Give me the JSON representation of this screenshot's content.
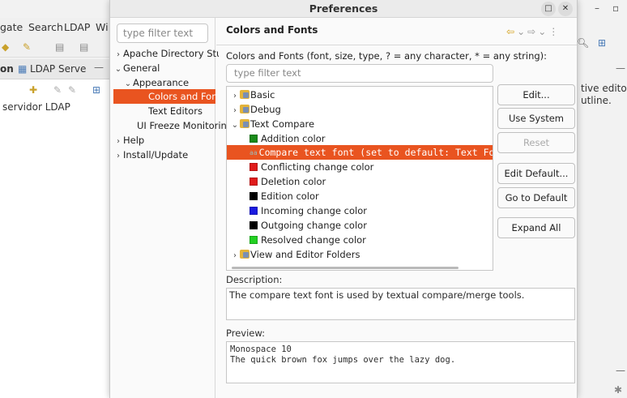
{
  "background_window": {
    "menu": [
      "gate",
      "Search",
      "LDAP",
      "Wi"
    ],
    "tabs": [
      "on",
      "LDAP Serve"
    ],
    "left_text": "servidor LDAP",
    "right_text_1": "tive editor th",
    "right_text_2": "utline."
  },
  "dialog": {
    "title": "Preferences",
    "minimize_icon": "□",
    "close_icon": "✕"
  },
  "left_tree": {
    "filter_placeholder": "type filter text",
    "items": [
      {
        "label": "Apache Directory Stu",
        "arrow": "›"
      },
      {
        "label": "General",
        "arrow": "⌄"
      },
      {
        "label": "Appearance",
        "arrow": "⌄"
      },
      {
        "label": "Colors and Fonts",
        "arrow": ""
      },
      {
        "label": "Text Editors",
        "arrow": ""
      },
      {
        "label": "UI Freeze Monitorin",
        "arrow": ""
      },
      {
        "label": "Help",
        "arrow": "›"
      },
      {
        "label": "Install/Update",
        "arrow": "›"
      }
    ]
  },
  "page": {
    "heading": "Colors and Fonts",
    "fonts_label": "Colors and Fonts (font, size, type, ? = any character, * = any string):",
    "filter_placeholder": "type filter text",
    "tree": [
      {
        "label": "Basic",
        "kind": "folder",
        "arrow": "›"
      },
      {
        "label": "Debug",
        "kind": "folder",
        "arrow": "›"
      },
      {
        "label": "Text Compare",
        "kind": "folder",
        "arrow": "⌄"
      },
      {
        "label": "Addition color",
        "kind": "color",
        "color": "#1a8a1a"
      },
      {
        "label": "Compare text font (set to default: Text Font)",
        "kind": "font"
      },
      {
        "label": "Conflicting change color",
        "kind": "color",
        "color": "#e01b1b"
      },
      {
        "label": "Deletion color",
        "kind": "color",
        "color": "#e01b1b"
      },
      {
        "label": "Edition color",
        "kind": "color",
        "color": "#000000"
      },
      {
        "label": "Incoming change color",
        "kind": "color",
        "color": "#1a1ae0"
      },
      {
        "label": "Outgoing change color",
        "kind": "color",
        "color": "#000000"
      },
      {
        "label": "Resolved change color",
        "kind": "color",
        "color": "#22d022"
      },
      {
        "label": "View and Editor Folders",
        "kind": "folder",
        "arrow": "›"
      }
    ],
    "buttons": {
      "edit": "Edit...",
      "use_system_font": "Use System Font",
      "reset": "Reset",
      "edit_default": "Edit Default...",
      "go_to_default": "Go to Default",
      "expand_all": "Expand All"
    },
    "description_label": "Description:",
    "description": "The compare text font is used by textual compare/merge tools.",
    "preview_label": "Preview:",
    "preview_line1": "Monospace 10",
    "preview_line2": "The quick brown fox jumps over the lazy dog."
  },
  "colors": {
    "selection": "#e95420"
  }
}
